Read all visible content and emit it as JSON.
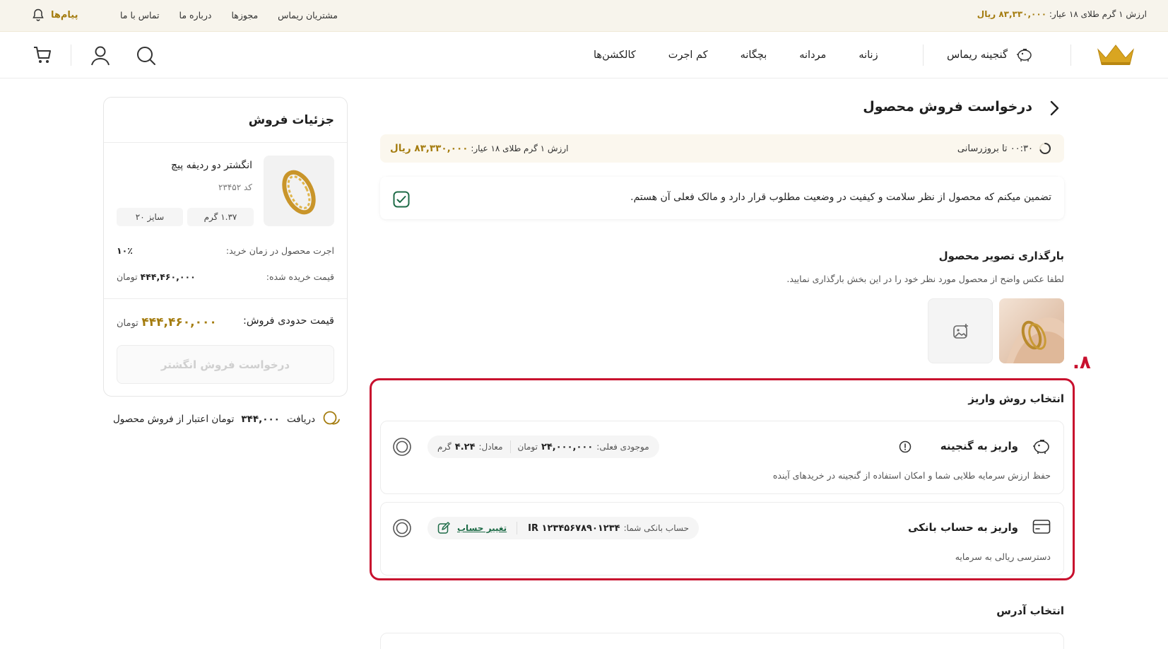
{
  "topbar": {
    "price_label": "ارزش ۱ گرم طلای ۱۸ عیار:",
    "price_value": "۸۳,۳۳۰,۰۰۰ ریال",
    "links": [
      "مشتریان ریماس",
      "مجوزها",
      "درباره ما",
      "تماس با ما"
    ],
    "messages_label": "پیام‌ها"
  },
  "nav": {
    "treasure_label": "گنجینه ریماس",
    "links": [
      "زنانه",
      "مردانه",
      "بچگانه",
      "کم اجرت",
      "کالکشن‌ها"
    ],
    "icons": [
      "search-icon",
      "user-icon",
      "cart-icon"
    ]
  },
  "main": {
    "page_title": "درخواست فروش محصول",
    "rate_bar": {
      "timer": "۰۰:۳۰ تا بروزرسانی",
      "price_label": "ارزش ۱ گرم طلای ۱۸ عیار:",
      "price_value": "۸۳,۳۳۰,۰۰۰ ریال"
    },
    "guarantee_text": "تضمین میکنم که محصول از نظر سلامت و کیفیت در وضعیت مطلوب قرار دارد و مالک فعلی آن  هستم.",
    "upload": {
      "title": "بارگذاری تصویر محصول",
      "hint": "لطفا عکس واضح از محصول مورد نظر خود را در این بخش بارگذاری نمایید."
    },
    "step_number": ".۸",
    "deposit": {
      "title": "انتخاب روش واریز",
      "treasure_option": {
        "title": "واریز به گنجینه",
        "desc": "حفظ ارزش سرمایه طلایی شما و امکان استفاده از گنجینه در خریدهای آینده",
        "balance_label": "موجودی فعلی:",
        "balance_value": "۲۴,۰۰۰,۰۰۰",
        "balance_unit": "تومان",
        "equiv_label": "معادل:",
        "equiv_value": "۴.۲۴",
        "equiv_unit": "گرم"
      },
      "bank_option": {
        "title": "واریز به حساب بانکی",
        "desc": "دسترسی ریالی به سرمایه",
        "account_label": "حساب بانکی شما:",
        "account_value": "IR ۱۲۳۴۵۶۷۸۹۰۱۲۳۴",
        "change_label": "تغییر حساب"
      }
    },
    "address_title": "انتخاب آدرس"
  },
  "sidebar": {
    "title": "جزئیات فروش",
    "product_name": "انگشتر دو ردیفه پیچ",
    "product_code": "کد ۲۳۴۵۲",
    "weight": "۱.۳۷ گرم",
    "size": "سایز ۲۰",
    "wage_label": "اجرت محصول در زمان خرید:",
    "wage_value": "۱۰٪",
    "purchase_label": "قیمت خریده شده:",
    "purchase_value": "۴۴۴,۴۶۰,۰۰۰",
    "purchase_unit": "تومان",
    "estimate_label": "قیمت حدودی فروش:",
    "estimate_value": "۴۴۴,۴۶۰,۰۰۰",
    "estimate_unit": "تومان",
    "sell_button": "درخواست فروش انگشتر"
  },
  "credit": {
    "prefix": "دریافت",
    "value": "۳۴۴,۰۰۰",
    "suffix": "تومان اعتبار از فروش محصول"
  },
  "colors": {
    "gold": "#a47c0f",
    "highlight": "#c8102e",
    "green": "#1e6b47"
  }
}
